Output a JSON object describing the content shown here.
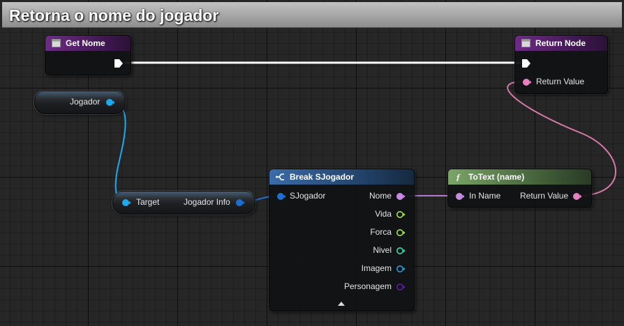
{
  "graph": {
    "title": "Retorna o nome do jogador"
  },
  "nodes": {
    "get_nome": {
      "title": "Get Nome"
    },
    "return_node": {
      "title": "Return Node",
      "return_value_label": "Return Value"
    },
    "jogador_var": {
      "label": "Jogador"
    },
    "get_jogador_info": {
      "target_label": "Target",
      "output_label": "Jogador Info"
    },
    "break_sjogador": {
      "title": "Break SJogador",
      "input_label": "SJogador",
      "outputs": [
        "Nome",
        "Vida",
        "Forca",
        "Nivel",
        "Imagem",
        "Personagem"
      ]
    },
    "to_text": {
      "title": "ToText (name)",
      "input_label": "In Name",
      "output_label": "Return Value"
    }
  },
  "icons": {
    "function_entry": "function-entry-icon",
    "return": "return-node-icon",
    "break_struct": "break-struct-icon",
    "function": "f-function-icon",
    "collapse": "collapse-arrow-icon"
  },
  "colors": {
    "exec": "#ffffff",
    "string_pin": "#e77fc2",
    "struct_pin": "#1b6fd1",
    "object_pin": "#1faaf0",
    "name_pin": "#c88be3",
    "int_pin": "#a3e34f",
    "float_pin": "#32dfa0",
    "texture_pin": "#2a9bd6",
    "class_pin": "#5b1ea8"
  }
}
